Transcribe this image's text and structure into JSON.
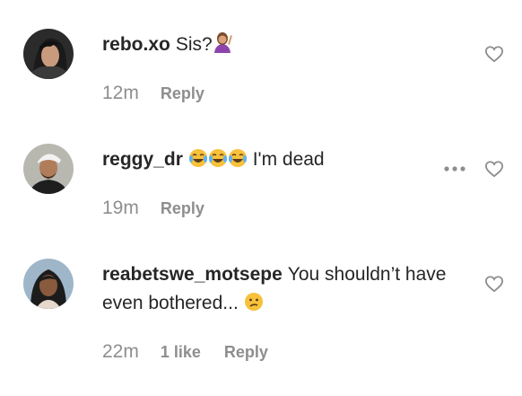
{
  "comments": [
    {
      "username": "rebo.xo",
      "text": "Sis?",
      "emoji": [
        "woman-raising-hand-icon"
      ],
      "time": "12m",
      "likes": "",
      "reply_label": "Reply"
    },
    {
      "username": "reggy_dr",
      "text": "I'm dead",
      "emoji": [
        "tears-of-joy-icon",
        "tears-of-joy-icon",
        "tears-of-joy-icon"
      ],
      "time": "19m",
      "likes": "",
      "reply_label": "Reply"
    },
    {
      "username": "reabetswe_motsepe",
      "text": "You shouldn’t have even bothered...",
      "emoji": [
        "confused-face-icon"
      ],
      "time": "22m",
      "likes": "1 like",
      "reply_label": "Reply"
    }
  ],
  "colors": {
    "text": "#262626",
    "meta": "#8e8e8e",
    "icon": "#8e8e8e",
    "emoji_yellow": "#f7c13a"
  }
}
